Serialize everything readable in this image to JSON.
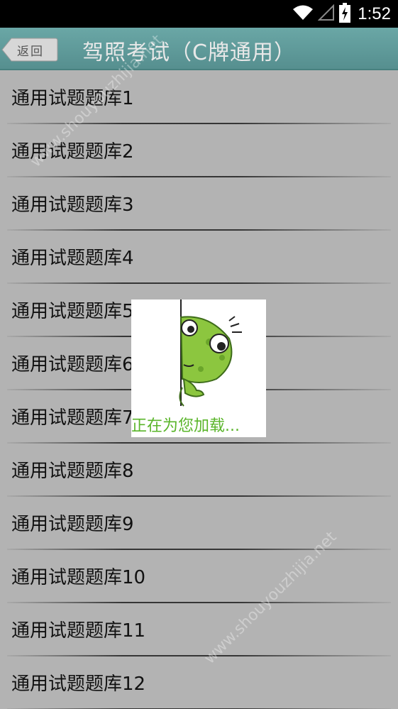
{
  "status_bar": {
    "time": "1:52",
    "icons": [
      "wifi-icon",
      "signal-icon",
      "battery-charging-icon"
    ]
  },
  "app_bar": {
    "back_label": "返回",
    "title": "驾照考试（C牌通用）"
  },
  "list": {
    "items": [
      {
        "label": "通用试题题库1"
      },
      {
        "label": "通用试题题库2"
      },
      {
        "label": "通用试题题库3"
      },
      {
        "label": "通用试题题库4"
      },
      {
        "label": "通用试题题库5"
      },
      {
        "label": "通用试题题库6"
      },
      {
        "label": "通用试题题库7"
      },
      {
        "label": "通用试题题库8"
      },
      {
        "label": "通用试题题库9"
      },
      {
        "label": "通用试题题库10"
      },
      {
        "label": "通用试题题库11"
      },
      {
        "label": "通用试题题库12"
      }
    ]
  },
  "loading_dialog": {
    "message": "正在为您加载..."
  },
  "watermark": {
    "text": "www.shouyouzhijia.net"
  },
  "colors": {
    "app_bar": "#5f9b9b",
    "list_background": "#b3b3b3",
    "loading_text": "#5ab52a"
  }
}
